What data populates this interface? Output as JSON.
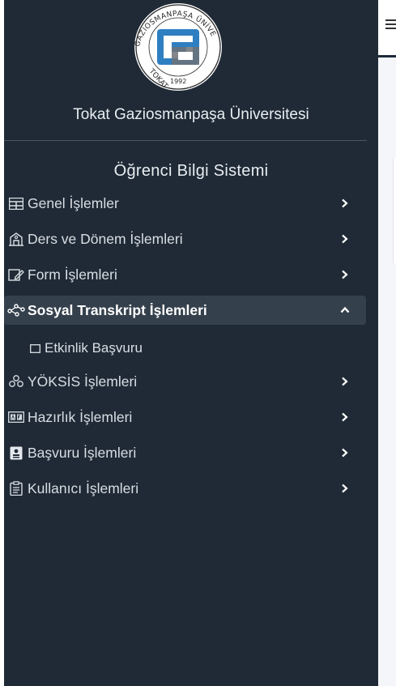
{
  "app": {
    "university_name": "Tokat Gaziosmanpaşa Üniversitesi",
    "system_title": "Öğrenci Bilgi Sistemi",
    "logo_text": {
      "ring": "GAZIOSMANPAŞA ÜNİVERSİTESİ",
      "left": "TOKAT",
      "year": "1992"
    }
  },
  "sidebar": {
    "items": [
      {
        "label": "Genel İşlemler",
        "icon": "table-icon",
        "expanded": false
      },
      {
        "label": "Ders ve Dönem İşlemleri",
        "icon": "building-icon",
        "expanded": false
      },
      {
        "label": "Form İşlemleri",
        "icon": "edit-form-icon",
        "expanded": false
      },
      {
        "label": "Sosyal Transkript İşlemleri",
        "icon": "share-nodes-icon",
        "expanded": true,
        "children": [
          {
            "label": "Etkinlik Başvuru",
            "icon": "square-icon"
          }
        ]
      },
      {
        "label": "YÖKSİS İşlemleri",
        "icon": "sitemap-icon",
        "expanded": false
      },
      {
        "label": "Hazırlık İşlemleri",
        "icon": "keyboard-icon",
        "expanded": false
      },
      {
        "label": "Başvuru İşlemleri",
        "icon": "id-card-icon",
        "expanded": false
      },
      {
        "label": "Kullanıcı İşlemleri",
        "icon": "clipboard-icon",
        "expanded": false
      }
    ]
  },
  "colors": {
    "sidebar_bg": "#1f2a36",
    "active_bg": "#34404c",
    "logo_blue": "#2e7fc1",
    "logo_gray": "#6d7277"
  }
}
